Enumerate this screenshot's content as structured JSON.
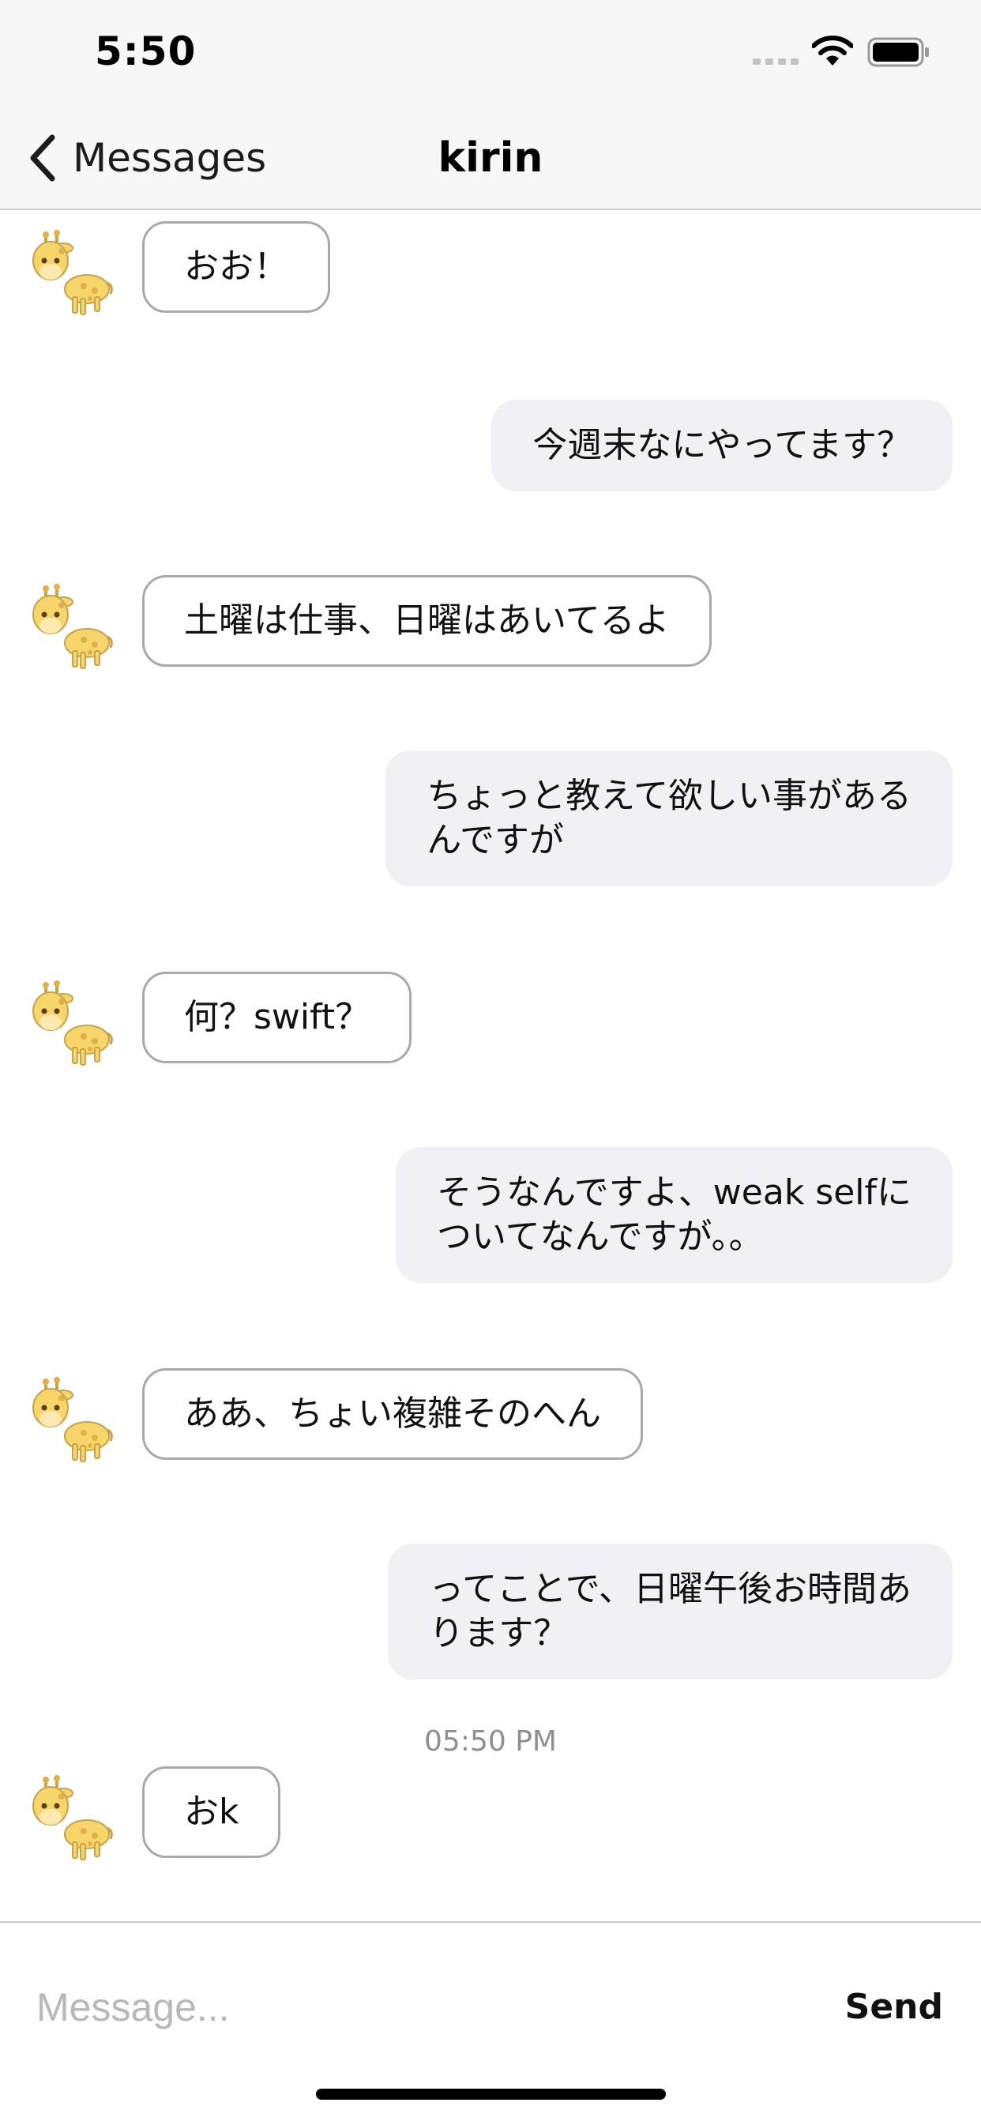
{
  "status_bar": {
    "time": "5:50"
  },
  "nav": {
    "back_label": "Messages",
    "title": "kirin"
  },
  "messages": [
    {
      "side": "in",
      "text": "おお！"
    },
    {
      "side": "out",
      "text": "今週末なにやってます？"
    },
    {
      "side": "in",
      "text": "土曜は仕事、日曜はあいてるよ"
    },
    {
      "side": "out",
      "line1": "ちょっと教えて欲しい事がある",
      "line2": "んですが"
    },
    {
      "side": "in",
      "text": "何？swift？"
    },
    {
      "side": "out",
      "line1": "そうなんですよ、weak selfに",
      "line2": "ついてなんですが。。"
    },
    {
      "side": "in",
      "text": "ああ、ちょい複雑そのへん"
    },
    {
      "side": "out",
      "line1": "ってことで、日曜午後お時間あ",
      "line2": "ります？"
    },
    {
      "side": "in",
      "text": "おk",
      "timestamp": "05:50 PM"
    }
  ],
  "input": {
    "placeholder": "Message...",
    "value": "",
    "send_label": "Send"
  },
  "icons": {
    "avatar": "giraffe-icon",
    "back": "chevron-left-icon",
    "signal": "cellular-signal-icon",
    "wifi": "wifi-icon",
    "battery": "battery-icon"
  },
  "colors": {
    "outgoing_bubble": "#f0f0f5",
    "incoming_border": "#a9a9ad",
    "timestamp": "#8e8e93"
  }
}
